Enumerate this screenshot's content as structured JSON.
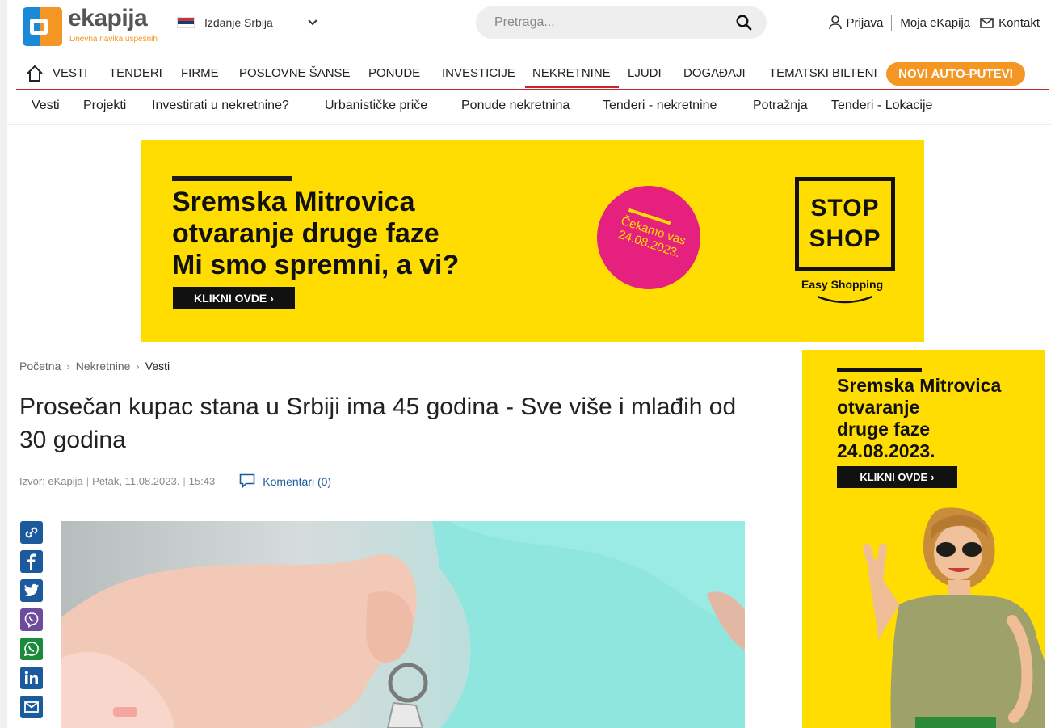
{
  "brand": {
    "name": "ekapija",
    "tagline": "Dnevna navika uspešnih",
    "colors": {
      "blue": "#1a8ad6",
      "orange": "#f39623",
      "red": "#c8262c",
      "yellow": "#ffdd00"
    }
  },
  "edition": {
    "label": "Izdanje Srbija"
  },
  "search": {
    "placeholder": "Pretraga..."
  },
  "toplinks": {
    "login": "Prijava",
    "my": "Moja eKapija",
    "contact": "Kontakt"
  },
  "mainnav": {
    "items": [
      "VESTI",
      "TENDERI",
      "FIRME",
      "POSLOVNE ŠANSE",
      "PONUDE",
      "INVESTICIJE",
      "NEKRETNINE",
      "LJUDI",
      "DOGAĐAJI",
      "TEMATSKI BILTENI"
    ],
    "active": "NEKRETNINE",
    "highlight": "NOVI AUTO-PUTEVI"
  },
  "subnav": {
    "items": [
      "Vesti",
      "Projekti",
      "Investirati u nekretnine?",
      "Urbanističke priče",
      "Ponude nekretnina",
      "Tenderi - nekretnine",
      "Potražnja",
      "Tenderi - Lokacije"
    ]
  },
  "banner": {
    "line1": "Sremska Mitrovica",
    "line2": "otvaranje druge faze",
    "line3": "Mi smo spremni, a vi?",
    "cta": "KLIKNI OVDE",
    "badge_line1": "Čekamo vas",
    "badge_line2": "24.08.2023.",
    "brand_line1": "STOP",
    "brand_line2": "SHOP",
    "brand_sub": "Easy Shopping"
  },
  "breadcrumb": {
    "home": "Početna",
    "section": "Nekretnine",
    "current": "Vesti"
  },
  "article": {
    "title": "Prosečan kupac stana u Srbiji ima 45 godina - Sve više i mlađih od 30 godina",
    "source": "Izvor: eKapija",
    "day": "Petak, 11.08.2023.",
    "time": "15:43",
    "comments": "Komentari (0)"
  },
  "share": {
    "icons": [
      "link-icon",
      "facebook-icon",
      "twitter-icon",
      "viber-icon",
      "whatsapp-icon",
      "linkedin-icon",
      "email-icon"
    ]
  },
  "sidead": {
    "line1": "Sremska Mitrovica",
    "line2": "otvaranje",
    "line3": "druge faze",
    "line4": "24.08.2023.",
    "cta": "KLIKNI OVDE"
  }
}
